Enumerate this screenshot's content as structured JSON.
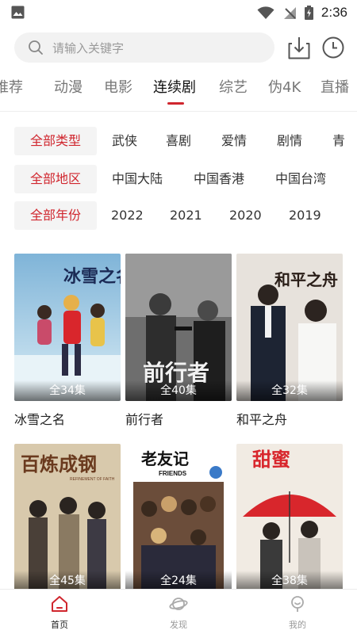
{
  "status_bar": {
    "time": "2:36"
  },
  "search": {
    "placeholder": "请输入关键字"
  },
  "tabs": [
    {
      "label": "推荐"
    },
    {
      "label": "动漫"
    },
    {
      "label": "电影"
    },
    {
      "label": "连续剧"
    },
    {
      "label": "综艺"
    },
    {
      "label": "伪4K"
    },
    {
      "label": "直播"
    }
  ],
  "active_tab": "连续剧",
  "filters": {
    "type": {
      "selected": "全部类型",
      "options": [
        "武侠",
        "喜剧",
        "爱情",
        "剧情",
        "青"
      ]
    },
    "region": {
      "selected": "全部地区",
      "options": [
        "中国大陆",
        "中国香港",
        "中国台湾"
      ]
    },
    "year": {
      "selected": "全部年份",
      "options": [
        "2022",
        "2021",
        "2020",
        "2019"
      ]
    }
  },
  "shows": [
    {
      "title": "冰雪之名",
      "episodes": "全34集",
      "poster_text": "冰雪之名"
    },
    {
      "title": "前行者",
      "episodes": "全40集",
      "poster_text": "前行者"
    },
    {
      "title": "和平之舟",
      "episodes": "全32集",
      "poster_text": "和平之舟"
    },
    {
      "title": "",
      "episodes": "全45集",
      "poster_text": "百炼成钢",
      "poster_subtext": "REFINEMENT OF FAITH"
    },
    {
      "title": "",
      "episodes": "全24集",
      "poster_text": "老友记",
      "poster_subtext": "FRIENDS"
    },
    {
      "title": "",
      "episodes": "全38集",
      "poster_text": "甜蜜"
    }
  ],
  "bottom_nav": [
    {
      "label": "首页",
      "icon": "home-icon"
    },
    {
      "label": "发现",
      "icon": "planet-icon"
    },
    {
      "label": "我的",
      "icon": "profile-icon"
    }
  ],
  "colors": {
    "accent": "#d0262e",
    "chip_bg": "#f4f4f4",
    "search_bg": "#f2f2f2"
  }
}
